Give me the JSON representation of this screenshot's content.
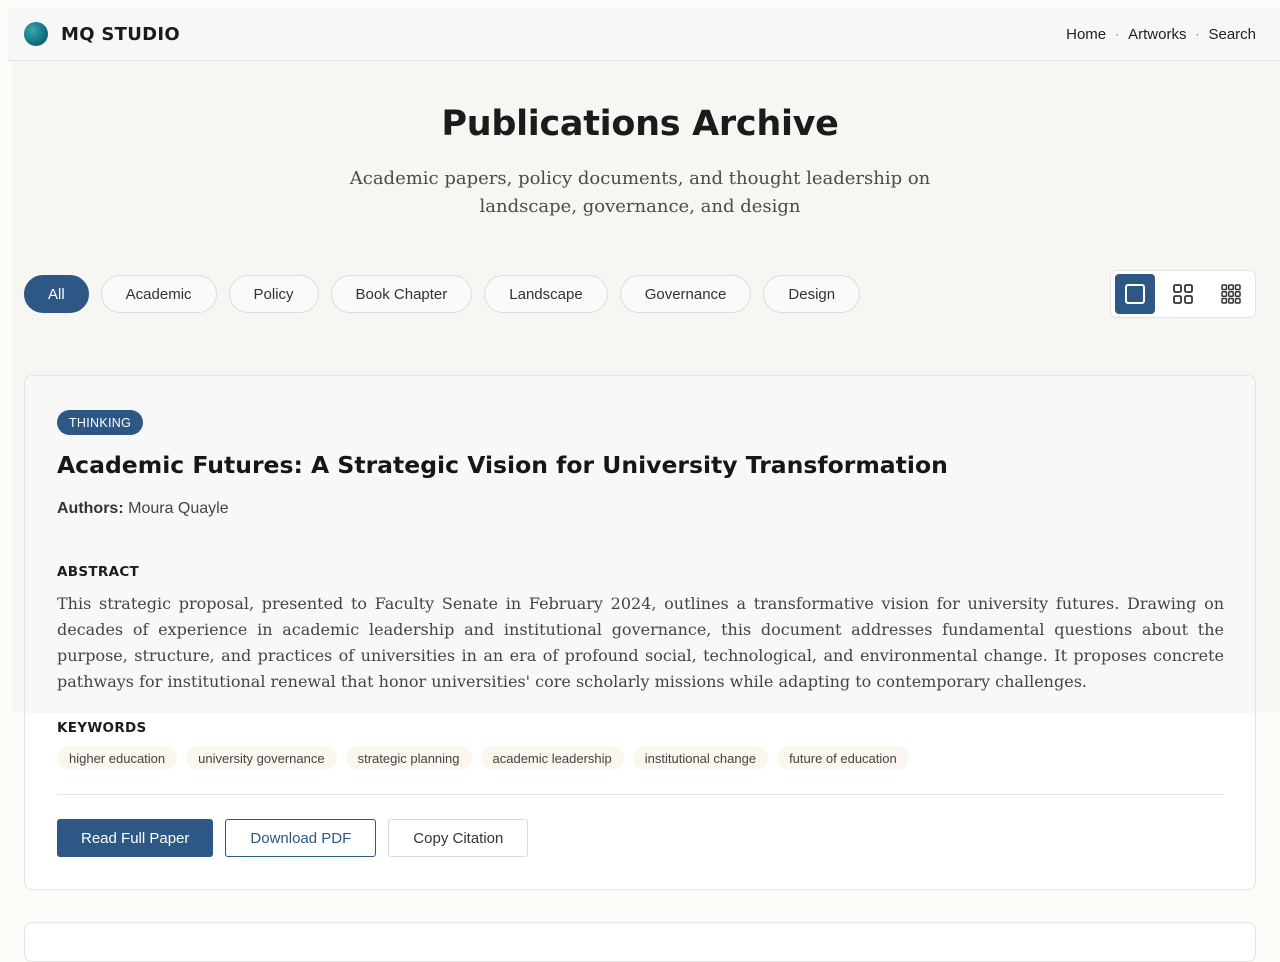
{
  "brand": {
    "name": "MQ STUDIO"
  },
  "nav": {
    "items": [
      "Home",
      "Artworks",
      "Search"
    ]
  },
  "hero": {
    "title": "Publications Archive",
    "subtitle": "Academic papers, policy documents, and thought leadership on landscape, governance, and design"
  },
  "filters": [
    "All",
    "Academic",
    "Policy",
    "Book Chapter",
    "Landscape",
    "Governance",
    "Design"
  ],
  "view_toggle": {
    "active": "single-column",
    "options": [
      "single-column-icon",
      "grid-2x2-icon",
      "grid-3x3-icon"
    ]
  },
  "card": {
    "badge": "THINKING",
    "title": "Academic Futures: A Strategic Vision for University Transformation",
    "authors_label": "Authors:",
    "authors": "Moura Quayle",
    "abstract_label": "ABSTRACT",
    "abstract": "This strategic proposal, presented to Faculty Senate in February 2024, outlines a transformative vision for university futures. Drawing on decades of experience in academic leadership and institutional governance, this document addresses fundamental questions about the purpose, structure, and practices of universities in an era of profound social, technological, and environmental change. It proposes concrete pathways for institutional renewal that honor universities' core scholarly missions while adapting to contemporary challenges.",
    "keywords_label": "KEYWORDS",
    "keywords": [
      "higher education",
      "university governance",
      "strategic planning",
      "academic leadership",
      "institutional change",
      "future of education"
    ],
    "actions": {
      "read": "Read Full Paper",
      "download": "Download PDF",
      "cite": "Copy Citation"
    }
  },
  "colors": {
    "accent": "#2d5784",
    "keyword_bg": "#fbf6ee",
    "page_bg": "#fdfbf7"
  }
}
